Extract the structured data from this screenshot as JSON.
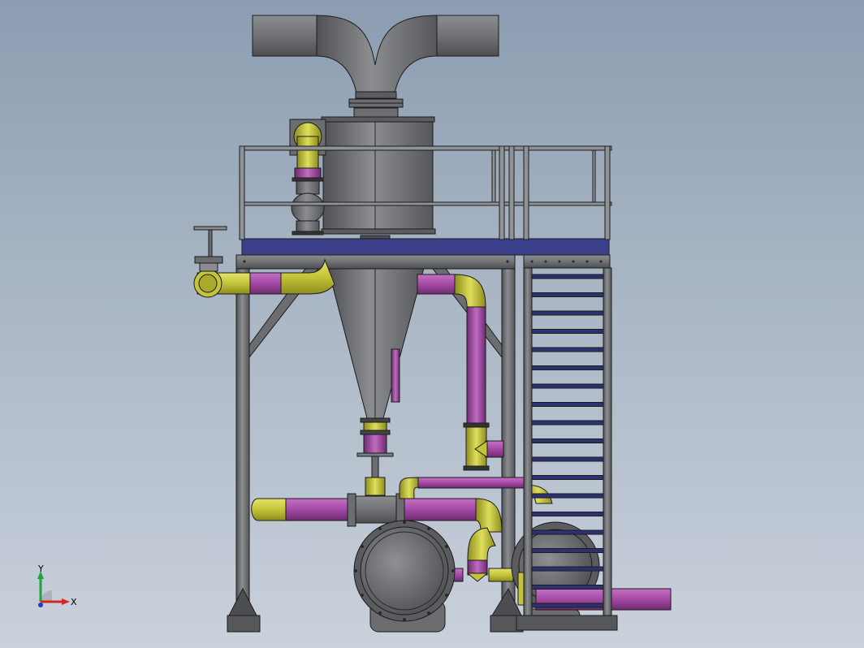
{
  "viewport": {
    "background_top": "#8c9db1",
    "background_bottom": "#c9d1db"
  },
  "colors": {
    "steel": "#6b6d70",
    "steel_light": "#8a8c8f",
    "steel_dark": "#444649",
    "pipe_yellow": "#c9c93a",
    "pipe_magenta": "#a44aa5",
    "platform_deck": "#3b3f8a",
    "stair_tread": "#2e3170",
    "railing": "#8f9296",
    "outline": "#1c1c1c"
  },
  "triad": {
    "x_label": "X",
    "y_label": "Y",
    "x_color": "#d8241c",
    "y_color": "#1fa43a",
    "z_color": "#1f3fbf"
  }
}
